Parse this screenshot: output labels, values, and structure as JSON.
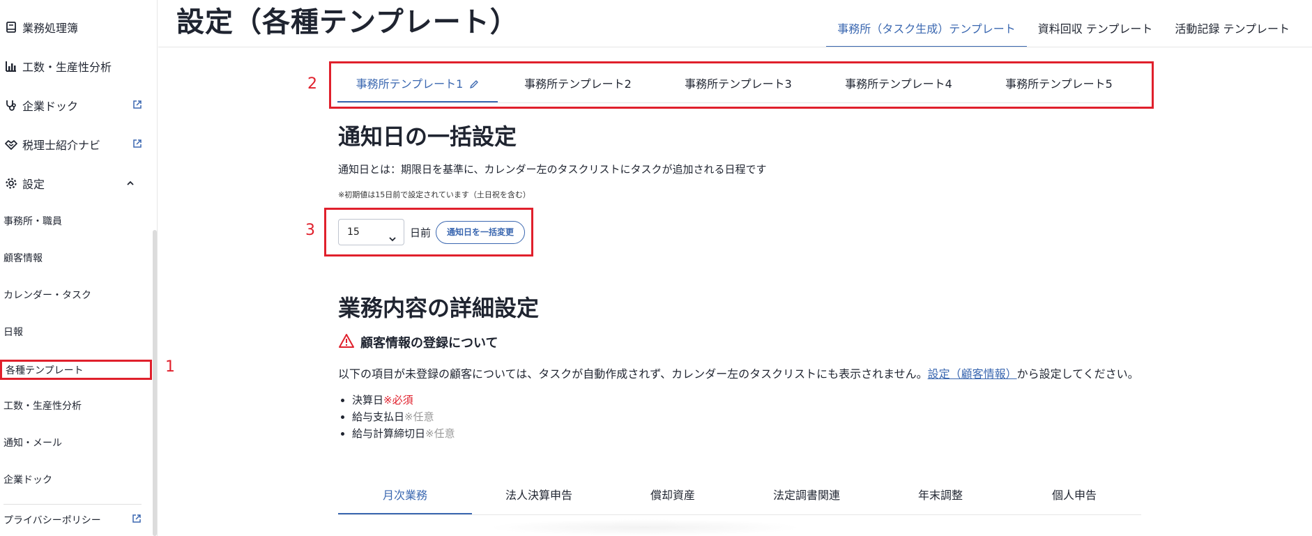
{
  "sidebar": {
    "main_items": [
      {
        "label": "業務処理簿",
        "icon": "ledger-icon"
      },
      {
        "label": "工数・生産性分析",
        "icon": "bar-chart-icon"
      },
      {
        "label": "企業ドック",
        "icon": "stethoscope-icon",
        "external": true
      },
      {
        "label": "税理士紹介ナビ",
        "icon": "handshake-icon",
        "external": true
      },
      {
        "label": "設定",
        "icon": "gear-icon",
        "expanded": true
      }
    ],
    "sub_items": [
      "事務所・職員",
      "顧客情報",
      "カレンダー・タスク",
      "日報",
      "各種テンプレート",
      "工数・生産性分析",
      "通知・メール",
      "企業ドック"
    ],
    "active_sub_item": "各種テンプレート",
    "footer_item": "プライバシーポリシー"
  },
  "header": {
    "title": "設定（各種テンプレート）",
    "tabs": [
      "事務所（タスク生成）テンプレート",
      "資料回収 テンプレート",
      "活動記録 テンプレート"
    ],
    "active_tab": 0
  },
  "template_tabs": {
    "items": [
      "事務所テンプレート1",
      "事務所テンプレート2",
      "事務所テンプレート3",
      "事務所テンプレート4",
      "事務所テンプレート5"
    ],
    "active": 0
  },
  "annotations": [
    "1",
    "2",
    "3"
  ],
  "notify": {
    "heading": "通知日の一括設定",
    "description": "通知日とは：期限日を基準に、カレンダー左のタスクリストにタスクが追加される日程です",
    "note": "※初期値は15日前で設定されています（土日祝を含む）",
    "days_value": "15",
    "days_suffix": "日前",
    "bulk_button": "通知日を一括変更"
  },
  "details": {
    "heading": "業務内容の詳細設定",
    "warning_title": "顧客情報の登録について",
    "info_prefix": "以下の項目が未登録の顧客については、タスクが自動作成されず、カレンダー左のタスクリストにも表示されません。",
    "info_link": "設定（顧客情報）",
    "info_suffix": "から設定してください。",
    "fields": [
      {
        "label": "決算日",
        "tag": "※必須"
      },
      {
        "label": "給与支払日",
        "tag": "※任意"
      },
      {
        "label": "給与計算締切日",
        "tag": "※任意"
      }
    ]
  },
  "business_tabs": {
    "items": [
      "月次業務",
      "法人決算申告",
      "償却資産",
      "法定調書関連",
      "年末調整",
      "個人申告"
    ],
    "active": 0
  },
  "colors": {
    "accent": "#3a67b0",
    "highlight": "#e0202c",
    "text": "#1f2430"
  }
}
